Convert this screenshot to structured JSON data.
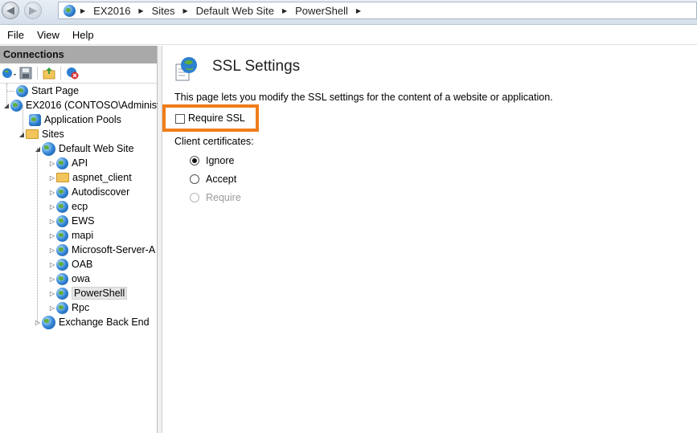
{
  "breadcrumb": [
    "EX2016",
    "Sites",
    "Default Web Site",
    "PowerShell"
  ],
  "menu": [
    "File",
    "View",
    "Help"
  ],
  "connections": {
    "title": "Connections",
    "tree": {
      "start_page": "Start Page",
      "server": "EX2016 (CONTOSO\\Administ",
      "app_pools": "Application Pools",
      "sites": "Sites",
      "default_web_site": "Default Web Site",
      "children": [
        "API",
        "aspnet_client",
        "Autodiscover",
        "ecp",
        "EWS",
        "mapi",
        "Microsoft-Server-A",
        "OAB",
        "owa",
        "PowerShell",
        "Rpc"
      ],
      "exchange_back_end": "Exchange Back End",
      "selected": "PowerShell"
    }
  },
  "page": {
    "title": "SSL Settings",
    "description": "This page lets you modify the SSL settings for the content of a website or application.",
    "require_ssl_label": "Require SSL",
    "require_ssl_checked": false,
    "client_certificates_label": "Client certificates:",
    "client_cert_options": [
      {
        "label": "Ignore",
        "selected": true,
        "enabled": true
      },
      {
        "label": "Accept",
        "selected": false,
        "enabled": true
      },
      {
        "label": "Require",
        "selected": false,
        "enabled": false
      }
    ]
  },
  "colors": {
    "highlight": "#f07d1a",
    "panel_header": "#a9a9a9"
  }
}
